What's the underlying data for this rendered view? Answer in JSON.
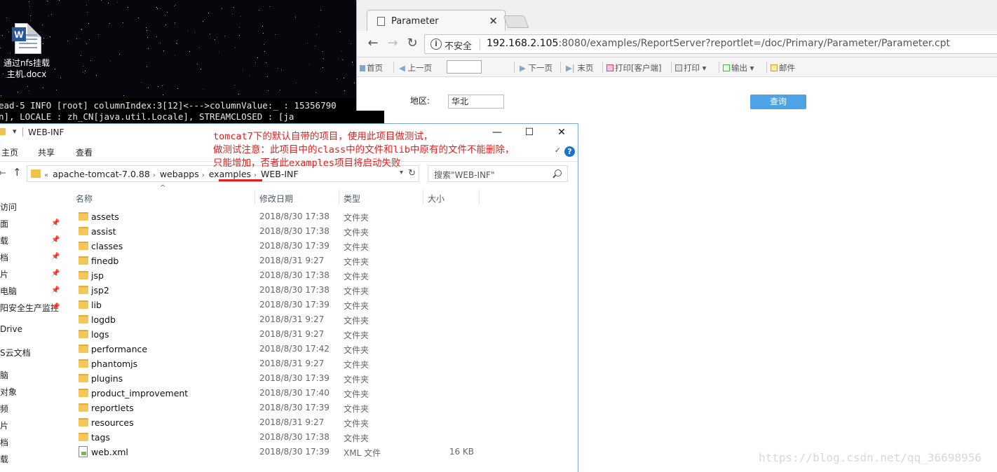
{
  "desktop": {
    "doc_icon": "word-document-icon",
    "doc_label_line1": "通过nfs挂载",
    "doc_label_line2": "主机.docx"
  },
  "terminal": {
    "line1": "ead-5 INFO [root] columnIndex:3[12]<--->columnValue:_ : 15356790",
    "line2": "n],   LOCALE   : zh_CN[java.util.Locale],   STREAMCLOSED   : [ja"
  },
  "browser": {
    "tab_title": "Parameter",
    "insecure_label": "不安全",
    "url_host": "192.168.2.105",
    "url_rest": ":8080/examples/ReportServer?reportlet=/doc/Primary/Parameter/Parameter.cpt",
    "toolbar": {
      "first": "首页",
      "prev": "上一页",
      "next": "下一页",
      "last": "末页",
      "print_client": "打印[客户端]",
      "print": "打印",
      "export": "输出",
      "email": "邮件"
    },
    "param_label": "地区:",
    "param_value": "华北",
    "query_button": "查询"
  },
  "explorer": {
    "title": "WEB-INF",
    "ribbon_tabs": [
      "主页",
      "共享",
      "查看"
    ],
    "breadcrumb": [
      "apache-tomcat-7.0.88",
      "webapps",
      "examples",
      "WEB-INF"
    ],
    "search_placeholder": "搜索\"WEB-INF\"",
    "nav_items": [
      "访问",
      "面",
      "载",
      "档",
      "片",
      "电脑",
      "阳安全生产监控",
      "Drive",
      "S云文档",
      "脑",
      "对象",
      "频",
      "片",
      "档",
      "载"
    ],
    "columns": {
      "name": "名称",
      "date": "修改日期",
      "type": "类型",
      "size": "大小"
    },
    "files": [
      {
        "name": "assets",
        "date": "2018/8/30 17:38",
        "type": "文件夹",
        "size": ""
      },
      {
        "name": "assist",
        "date": "2018/8/30 17:38",
        "type": "文件夹",
        "size": ""
      },
      {
        "name": "classes",
        "date": "2018/8/30 17:39",
        "type": "文件夹",
        "size": ""
      },
      {
        "name": "finedb",
        "date": "2018/8/31 9:27",
        "type": "文件夹",
        "size": ""
      },
      {
        "name": "jsp",
        "date": "2018/8/30 17:38",
        "type": "文件夹",
        "size": ""
      },
      {
        "name": "jsp2",
        "date": "2018/8/30 17:38",
        "type": "文件夹",
        "size": ""
      },
      {
        "name": "lib",
        "date": "2018/8/30 17:39",
        "type": "文件夹",
        "size": ""
      },
      {
        "name": "logdb",
        "date": "2018/8/31 9:27",
        "type": "文件夹",
        "size": ""
      },
      {
        "name": "logs",
        "date": "2018/8/31 9:27",
        "type": "文件夹",
        "size": ""
      },
      {
        "name": "performance",
        "date": "2018/8/30 17:42",
        "type": "文件夹",
        "size": ""
      },
      {
        "name": "phantomjs",
        "date": "2018/8/31 9:27",
        "type": "文件夹",
        "size": ""
      },
      {
        "name": "plugins",
        "date": "2018/8/30 17:39",
        "type": "文件夹",
        "size": ""
      },
      {
        "name": "product_improvement",
        "date": "2018/8/30 17:40",
        "type": "文件夹",
        "size": ""
      },
      {
        "name": "reportlets",
        "date": "2018/8/30 17:39",
        "type": "文件夹",
        "size": ""
      },
      {
        "name": "resources",
        "date": "2018/8/31 9:27",
        "type": "文件夹",
        "size": ""
      },
      {
        "name": "tags",
        "date": "2018/8/30 17:38",
        "type": "文件夹",
        "size": ""
      },
      {
        "name": "web.xml",
        "date": "2018/8/30 17:39",
        "type": "XML 文件",
        "size": "16 KB"
      }
    ]
  },
  "annotation": {
    "line1": "tomcat7下的默认自带的项目，使用此项目做测试，",
    "line2": "做测试注意：此项目中的class中的文件和lib中原有的文件不能删除，",
    "line3": "只能增加，否者此examples项目将启动失败",
    "color": "#e02020"
  },
  "watermark": "https://blog.csdn.net/qq_36698956"
}
